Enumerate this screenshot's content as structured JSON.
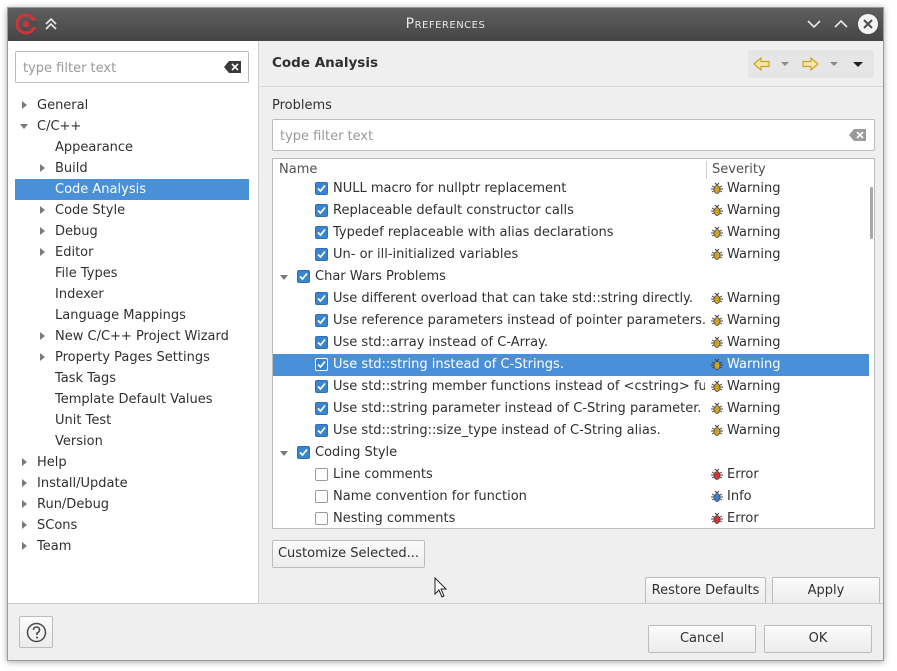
{
  "window": {
    "title": "Preferences"
  },
  "left": {
    "filter_placeholder": "type filter text",
    "tree": [
      {
        "label": "General",
        "level": 0,
        "expander": "collapsed"
      },
      {
        "label": "C/C++",
        "level": 0,
        "expander": "expanded"
      },
      {
        "label": "Appearance",
        "level": 1,
        "expander": "none"
      },
      {
        "label": "Build",
        "level": 1,
        "expander": "collapsed"
      },
      {
        "label": "Code Analysis",
        "level": 1,
        "expander": "none",
        "selected": true
      },
      {
        "label": "Code Style",
        "level": 1,
        "expander": "collapsed"
      },
      {
        "label": "Debug",
        "level": 1,
        "expander": "collapsed"
      },
      {
        "label": "Editor",
        "level": 1,
        "expander": "collapsed"
      },
      {
        "label": "File Types",
        "level": 1,
        "expander": "none"
      },
      {
        "label": "Indexer",
        "level": 1,
        "expander": "none"
      },
      {
        "label": "Language Mappings",
        "level": 1,
        "expander": "none"
      },
      {
        "label": "New C/C++ Project Wizard",
        "level": 1,
        "expander": "collapsed"
      },
      {
        "label": "Property Pages Settings",
        "level": 1,
        "expander": "collapsed"
      },
      {
        "label": "Task Tags",
        "level": 1,
        "expander": "none"
      },
      {
        "label": "Template Default Values",
        "level": 1,
        "expander": "none"
      },
      {
        "label": "Unit Test",
        "level": 1,
        "expander": "none"
      },
      {
        "label": "Version",
        "level": 1,
        "expander": "none"
      },
      {
        "label": "Help",
        "level": 0,
        "expander": "collapsed"
      },
      {
        "label": "Install/Update",
        "level": 0,
        "expander": "collapsed"
      },
      {
        "label": "Run/Debug",
        "level": 0,
        "expander": "collapsed"
      },
      {
        "label": "SCons",
        "level": 0,
        "expander": "collapsed"
      },
      {
        "label": "Team",
        "level": 0,
        "expander": "collapsed"
      }
    ]
  },
  "page": {
    "title": "Code Analysis",
    "problems_label": "Problems",
    "filter_placeholder": "type filter text",
    "columns": {
      "name": "Name",
      "severity": "Severity"
    },
    "rows": [
      {
        "kind": "item",
        "label": "NULL macro for nullptr replacement",
        "checked": true,
        "severity": "Warning"
      },
      {
        "kind": "item",
        "label": "Replaceable default constructor calls",
        "checked": true,
        "severity": "Warning"
      },
      {
        "kind": "item",
        "label": "Typedef replaceable with alias declarations",
        "checked": true,
        "severity": "Warning"
      },
      {
        "kind": "item",
        "label": "Un- or ill-initialized variables",
        "checked": true,
        "severity": "Warning"
      },
      {
        "kind": "group",
        "label": "Char Wars Problems",
        "checked": true
      },
      {
        "kind": "item",
        "label": "Use different overload that can take std::string directly.",
        "checked": true,
        "severity": "Warning"
      },
      {
        "kind": "item",
        "label": "Use reference parameters instead of pointer parameters.",
        "checked": true,
        "severity": "Warning"
      },
      {
        "kind": "item",
        "label": "Use std::array instead of C-Array.",
        "checked": true,
        "severity": "Warning"
      },
      {
        "kind": "item",
        "label": "Use std::string instead of C-Strings.",
        "checked": true,
        "severity": "Warning",
        "selected": true
      },
      {
        "kind": "item",
        "label": "Use std::string member functions instead of <cstring> functions.",
        "checked": true,
        "severity": "Warning"
      },
      {
        "kind": "item",
        "label": "Use std::string parameter instead of C-String parameter.",
        "checked": true,
        "severity": "Warning"
      },
      {
        "kind": "item",
        "label": "Use std::string::size_type instead of C-String alias.",
        "checked": true,
        "severity": "Warning"
      },
      {
        "kind": "group",
        "label": "Coding Style",
        "checked": true
      },
      {
        "kind": "item",
        "label": "Line comments",
        "checked": false,
        "severity": "Error"
      },
      {
        "kind": "item",
        "label": "Name convention for function",
        "checked": false,
        "severity": "Info"
      },
      {
        "kind": "item",
        "label": "Nesting comments",
        "checked": false,
        "severity": "Error"
      }
    ],
    "customize_label": "Customize Selected...",
    "restore_label": "Restore Defaults",
    "apply_label": "Apply"
  },
  "footer": {
    "cancel_label": "Cancel",
    "ok_label": "OK"
  },
  "colors": {
    "selection": "#4a90d9",
    "titlebar": "#4e4e4e",
    "warning": "#c9a227",
    "error": "#d0343a",
    "info": "#3a7fd0"
  },
  "icons": {
    "app": "cdt-logo-icon",
    "severity_warning": "bug-warning-icon",
    "severity_error": "bug-error-icon",
    "severity_info": "bug-info-icon"
  }
}
